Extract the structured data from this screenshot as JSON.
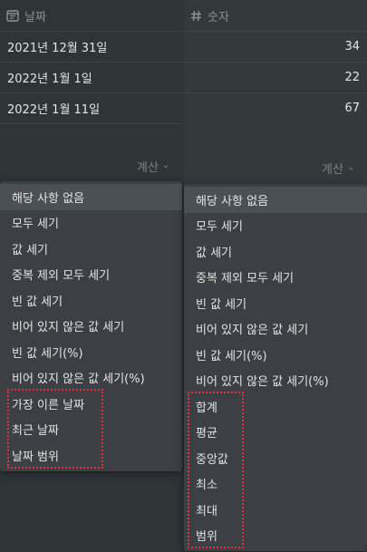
{
  "left_column": {
    "header_icon": "calendar-icon",
    "header_label": "날짜",
    "rows": [
      "2021년 12월 31일",
      "2022년 1월 1일",
      "2022년 1월 11일"
    ],
    "calc_label": "계산",
    "menu": [
      "해당 사항 없음",
      "모두 세기",
      "값 세기",
      "중복 제외 모두 세기",
      "빈 값 세기",
      "비어 있지 않은 값 세기",
      "빈 값 세기(%)",
      "비어 있지 않은 값 세기(%)",
      "가장 이른 날짜",
      "최근 날짜",
      "날짜 범위"
    ],
    "selected_index": 0
  },
  "right_column": {
    "header_icon": "hash-icon",
    "header_label": "숫자",
    "rows": [
      "34",
      "22",
      "67"
    ],
    "calc_label": "계산",
    "menu": [
      "해당 사항 없음",
      "모두 세기",
      "값 세기",
      "중복 제외 모두 세기",
      "빈 값 세기",
      "비어 있지 않은 값 세기",
      "빈 값 세기(%)",
      "비어 있지 않은 값 세기(%)",
      "합계",
      "평균",
      "중앙값",
      "최소",
      "최대",
      "범위"
    ],
    "selected_index": 0
  },
  "colors": {
    "background": "#2f3437",
    "menu_background": "#3c4044",
    "selected_background": "#4b5054",
    "highlight_border": "#e0323c",
    "text": "#e3e3e3",
    "muted_text": "#8f9396"
  }
}
